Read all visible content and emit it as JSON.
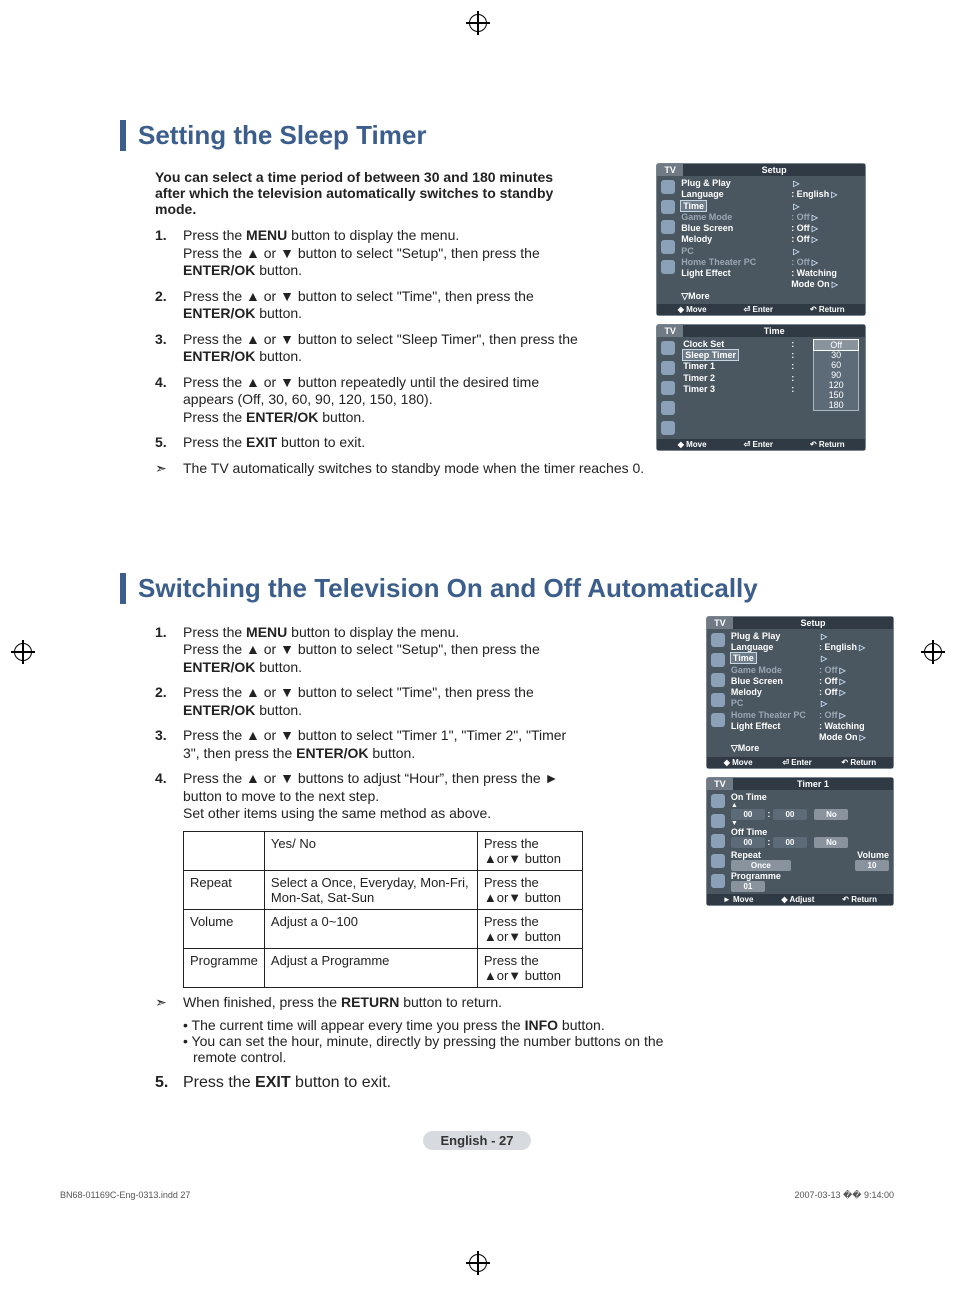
{
  "section1": {
    "title": "Setting the Sleep Timer",
    "intro": "You can select a time period of between 30 and 180 minutes after which the television automatically switches to standby mode.",
    "steps": [
      "Press the <b>MENU</b> button to display the menu.<br>Press the ▲ or ▼ button to select \"Setup\", then press the <b>ENTER/OK</b> button.",
      "Press the ▲ or ▼ button to select \"Time\", then press the <b>ENTER/OK</b> button.",
      "Press the ▲ or ▼ button to select \"Sleep Timer\", then press the <b>ENTER/OK</b> button.",
      "Press the ▲ or ▼ button repeatedly until the desired time appears (Off, 30, 60, 90, 120, 150, 180).<br>Press the <b>ENTER/OK</b> button.",
      "Press the <b>EXIT</b> button to exit."
    ],
    "note": "The TV automatically switches to standby mode when the timer reaches 0."
  },
  "section2": {
    "title": "Switching the Television On and Off Automatically",
    "steps": [
      "Press the <b>MENU</b> button to display the menu.<br>Press the ▲ or ▼ button to select \"Setup\", then press the <b>ENTER/OK</b> button.",
      "Press the ▲ or ▼ button to select \"Time\", then press the <b>ENTER/OK</b> button.",
      "Press the ▲ or ▼ button to select \"Timer 1\", \"Timer 2\", \"Timer 3\", then press the <b>ENTER/OK</b> button.",
      "Press the ▲ or ▼ buttons to adjust “Hour”, then press the ► button to move to the next step.<br>Set other items using the same method as above."
    ],
    "table": [
      [
        "",
        "Yes/ No",
        "Press the ▲or▼ button"
      ],
      [
        "Repeat",
        "Select a Once, Everyday, Mon-Fri, Mon-Sat, Sat-Sun",
        "Press the ▲or▼ button"
      ],
      [
        "Volume",
        "Adjust a 0~100",
        "Press the ▲or▼ button"
      ],
      [
        "Programme",
        "Adjust a Programme",
        "Press the ▲or▼ button"
      ]
    ],
    "note": "When finished, press the <b>RETURN</b> button to return.",
    "bullets": [
      "The current time will appear every time you press the <b>INFO</b> button.",
      "You can set the hour, minute, directly by pressing the number buttons on the remote control."
    ],
    "step5": "Press the <b>EXIT</b> button to exit."
  },
  "osd_setup": {
    "tv": "TV",
    "title": "Setup",
    "rows": [
      {
        "l": "Plug & Play",
        "v": "",
        "arr": true
      },
      {
        "l": "Language",
        "v": ": English",
        "arr": true
      },
      {
        "l": "Time",
        "v": "",
        "hl": true,
        "arr": true
      },
      {
        "l": "Game Mode",
        "v": ": Off",
        "dim": true,
        "arr": true
      },
      {
        "l": "Blue Screen",
        "v": ": Off",
        "arr": true
      },
      {
        "l": "Melody",
        "v": ": Off",
        "arr": true
      },
      {
        "l": "PC",
        "v": "",
        "dim": true,
        "arr": true
      },
      {
        "l": "Home Theater PC",
        "v": ": Off",
        "dim": true,
        "arr": true
      },
      {
        "l": "Light Effect",
        "v": ": Watching Mode On",
        "arr": true
      },
      {
        "l": "▽More",
        "v": ""
      }
    ],
    "ftr": [
      "◆ Move",
      "⏎ Enter",
      "↶ Return"
    ]
  },
  "osd_time": {
    "tv": "TV",
    "title": "Time",
    "rows": [
      {
        "l": "Clock Set",
        "v": ":"
      },
      {
        "l": "Sleep Timer",
        "v": ":",
        "hl": true
      },
      {
        "l": "Timer 1",
        "v": ":"
      },
      {
        "l": "Timer 2",
        "v": ":"
      },
      {
        "l": "Timer 3",
        "v": ":"
      }
    ],
    "options": [
      "Off",
      "30",
      "60",
      "90",
      "120",
      "150",
      "180"
    ],
    "ftr": [
      "◆ Move",
      "⏎ Enter",
      "↶ Return"
    ]
  },
  "osd_timer1": {
    "tv": "TV",
    "title": "Timer 1",
    "on_time": {
      "label": "On Time",
      "h": "00",
      "m": "00",
      "enabled": "No"
    },
    "off_time": {
      "label": "Off Time",
      "h": "00",
      "m": "00",
      "enabled": "No"
    },
    "repeat": {
      "label": "Repeat",
      "value": "Once"
    },
    "volume": {
      "label": "Volume",
      "value": "10"
    },
    "programme": {
      "label": "Programme",
      "value": "01"
    },
    "ftr": [
      "► Move",
      "◆ Adjust",
      "↶ Return"
    ]
  },
  "page_label": "English - 27",
  "footer": {
    "left": "BN68-01169C-Eng-0313.indd   27",
    "right": "2007-03-13   �� 9:14:00"
  }
}
